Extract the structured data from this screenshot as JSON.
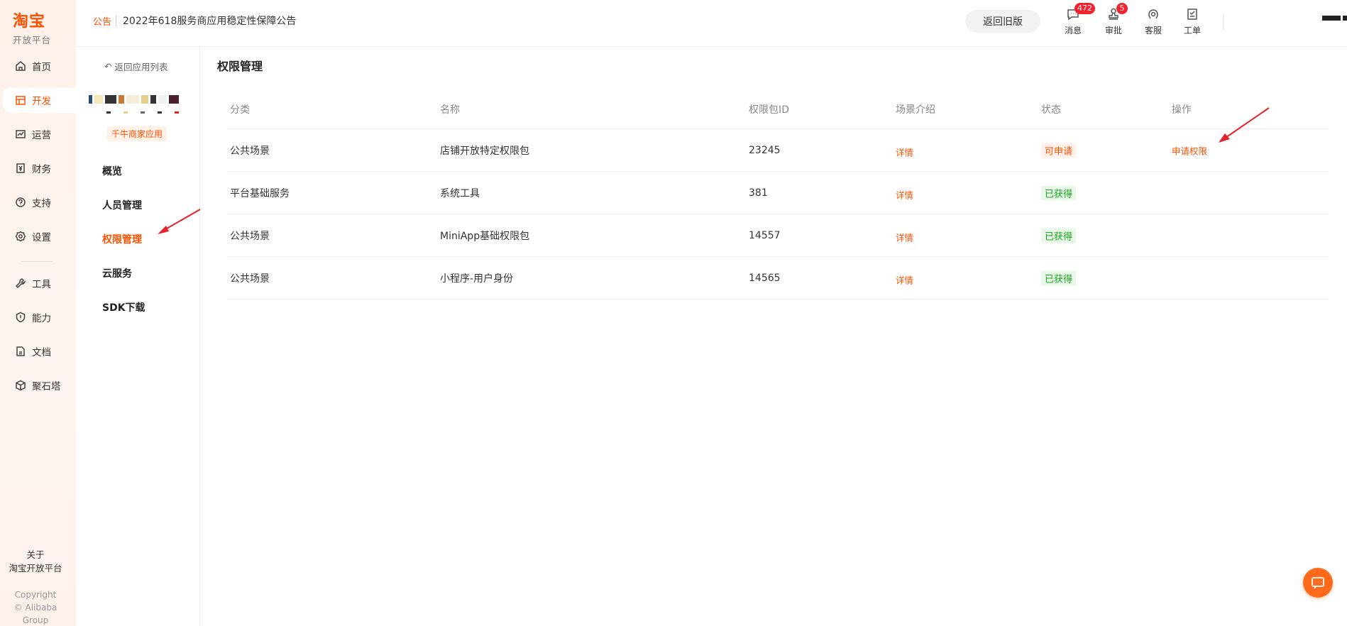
{
  "brand": {
    "logo": "淘宝",
    "subtitle": "开放平台"
  },
  "global_nav": {
    "items": [
      {
        "label": "首页",
        "icon": "home-icon"
      },
      {
        "label": "开发",
        "icon": "store-icon",
        "active": true
      },
      {
        "label": "运营",
        "icon": "chart-icon"
      },
      {
        "label": "财务",
        "icon": "yen-icon"
      },
      {
        "label": "支持",
        "icon": "help-icon"
      },
      {
        "label": "设置",
        "icon": "gear-icon"
      },
      {
        "label": "工具",
        "icon": "wrench-icon"
      },
      {
        "label": "能力",
        "icon": "shield-icon"
      },
      {
        "label": "文档",
        "icon": "doc-icon"
      },
      {
        "label": "聚石塔",
        "icon": "cube-icon"
      }
    ],
    "about_line1": "关于",
    "about_line2": "淘宝开放平台",
    "copyright_line1": "Copyright",
    "copyright_line2": "© Alibaba Group"
  },
  "topbar": {
    "notice_tag": "公告",
    "notice_text": "2022年618服务商应用稳定性保障公告",
    "back_old_label": "返回旧版",
    "tools": [
      {
        "label": "消息",
        "badge": "472",
        "icon": "message-icon"
      },
      {
        "label": "审批",
        "badge": "5",
        "icon": "stamp-icon"
      },
      {
        "label": "客服",
        "icon": "headset-icon"
      },
      {
        "label": "工单",
        "icon": "ticket-icon"
      }
    ]
  },
  "subnav": {
    "back_label": "返回应用列表",
    "app_tag": "千牛商家应用",
    "items": [
      {
        "label": "概览"
      },
      {
        "label": "人员管理"
      },
      {
        "label": "权限管理",
        "active": true
      },
      {
        "label": "云服务"
      },
      {
        "label": "SDK下载"
      }
    ]
  },
  "main": {
    "title": "权限管理",
    "columns": [
      "分类",
      "名称",
      "权限包ID",
      "场景介绍",
      "状态",
      "操作"
    ],
    "rows": [
      {
        "category": "公共场景",
        "name": "店铺开放特定权限包",
        "id": "23245",
        "detail": "详情",
        "status": "可申请",
        "status_type": "apply",
        "action": "申请权限"
      },
      {
        "category": "平台基础服务",
        "name": "系统工具",
        "id": "381",
        "detail": "详情",
        "status": "已获得",
        "status_type": "ok",
        "action": ""
      },
      {
        "category": "公共场景",
        "name": "MiniApp基础权限包",
        "id": "14557",
        "detail": "详情",
        "status": "已获得",
        "status_type": "ok",
        "action": ""
      },
      {
        "category": "公共场景",
        "name": "小程序-用户身份",
        "id": "14565",
        "detail": "详情",
        "status": "已获得",
        "status_type": "ok",
        "action": ""
      }
    ]
  },
  "colors": {
    "accent": "#ff5000",
    "success": "#19a819",
    "arrow": "#e8202a"
  }
}
